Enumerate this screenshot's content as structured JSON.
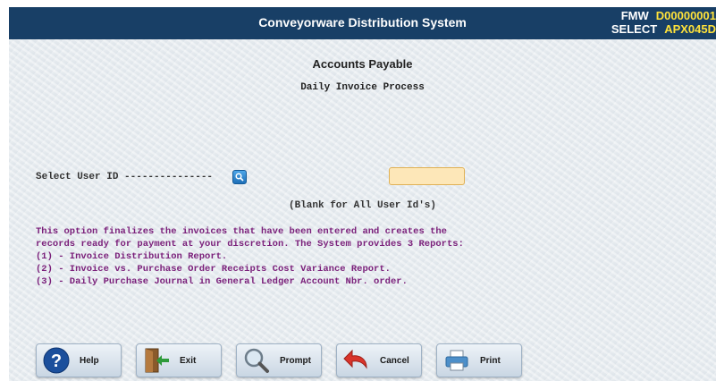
{
  "header": {
    "title": "Conveyorware Distribution System",
    "program_label": "FMW",
    "program_value": "D00000001",
    "mode_label": "SELECT",
    "screen_id": "APX045D"
  },
  "main": {
    "heading": "Accounts Payable",
    "subheading": "Daily Invoice Process",
    "field_label": "Select User ID ---------------",
    "user_id_value": "",
    "hint": "(Blank for All User Id's)",
    "description": [
      "This option finalizes the invoices that have been entered and creates the",
      "records ready for payment at your discretion. The System provides 3 Reports:",
      "(1) - Invoice Distribution Report.",
      "(2) - Invoice vs. Purchase Order Receipts Cost Variance Report.",
      "(3) - Daily Purchase Journal in General Ledger Account Nbr. order."
    ]
  },
  "buttons": {
    "help": "Help",
    "exit": "Exit",
    "prompt": "Prompt",
    "cancel": "Cancel",
    "print": "Print"
  },
  "icons": {
    "help": "help-icon",
    "exit": "exit-door-icon",
    "prompt": "magnifier-icon",
    "cancel": "undo-arrow-icon",
    "print": "printer-icon",
    "field_prompt": "search-icon"
  },
  "colors": {
    "title_bar": "#183f66",
    "highlight": "#ffe23a",
    "description_text": "#7a1f7a",
    "input_bg": "#fde7b8"
  }
}
